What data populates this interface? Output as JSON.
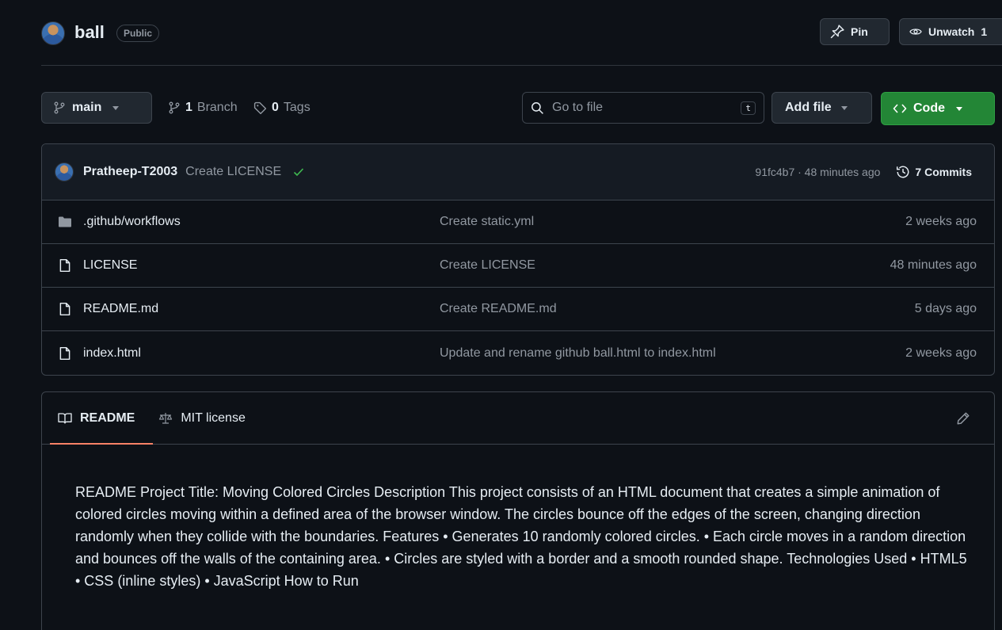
{
  "repo": {
    "name": "ball",
    "visibility": "Public"
  },
  "actions": {
    "pin_label": "Pin",
    "unwatch_label": "Unwatch",
    "watch_count": "1"
  },
  "branch": {
    "current": "main",
    "branch_count": "1",
    "branch_label": "Branch",
    "tag_count": "0",
    "tag_label": "Tags"
  },
  "search": {
    "placeholder": "Go to file",
    "shortcut": "t"
  },
  "buttons": {
    "add_file": "Add file",
    "code": "Code"
  },
  "commit": {
    "author": "Pratheep-T2003",
    "message": "Create LICENSE",
    "hash_time": "91fc4b7 · 48 minutes ago",
    "commits_label": "7 Commits"
  },
  "files": [
    {
      "name": ".github/workflows",
      "type": "folder",
      "message": "Create static.yml",
      "time": "2 weeks ago"
    },
    {
      "name": "LICENSE",
      "type": "file",
      "message": "Create LICENSE",
      "time": "48 minutes ago"
    },
    {
      "name": "README.md",
      "type": "file",
      "message": "Create README.md",
      "time": "5 days ago"
    },
    {
      "name": "index.html",
      "type": "file",
      "message": "Update and rename github ball.html to index.html",
      "time": "2 weeks ago"
    }
  ],
  "readme": {
    "tab_readme": "README",
    "tab_license": "MIT license",
    "content": "README Project Title: Moving Colored Circles Description This project consists of an HTML document that creates a simple animation of colored circles moving within a defined area of the browser window. The circles bounce off the edges of the screen, changing direction randomly when they collide with the boundaries. Features • Generates 10 randomly colored circles. • Each circle moves in a random direction and bounces off the walls of the containing area. • Circles are styled with a border and a smooth rounded shape. Technologies Used • HTML5 • CSS (inline styles) • JavaScript How to Run"
  },
  "colors": {
    "accent_green": "#238636",
    "tab_underline": "#f78166",
    "check_green": "#3fb950"
  }
}
